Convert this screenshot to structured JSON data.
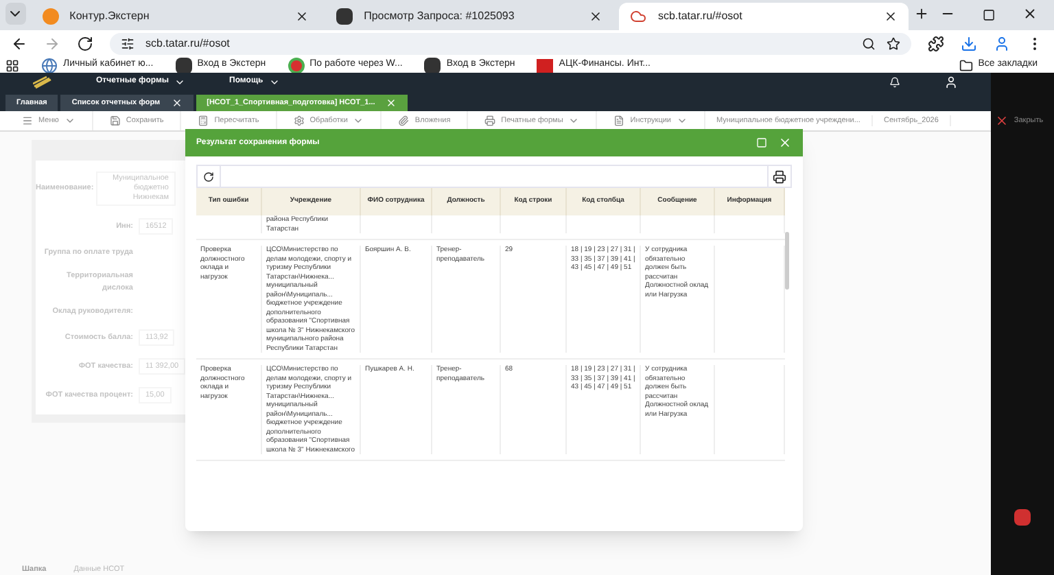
{
  "browser": {
    "tabs": [
      {
        "title": "Контур.Экстерн",
        "kind": "kontur",
        "selected": false
      },
      {
        "title": "Просмотр Запроса: #1025093",
        "kind": "k",
        "selected": false
      },
      {
        "title": "scb.tatar.ru/#osot",
        "kind": "cloud",
        "selected": true
      }
    ],
    "address": "scb.tatar.ru/#osot",
    "bookmarks": [
      {
        "title": "Личный кабинет ю...",
        "kind": "globe"
      },
      {
        "title": "Вход в Экстерн",
        "kind": "k"
      },
      {
        "title": "По работе через W...",
        "kind": "round"
      },
      {
        "title": "Вход в Экстерн",
        "kind": "k"
      },
      {
        "title": "АЦК-Финансы. Инт...",
        "kind": "ack"
      }
    ],
    "all_bookmarks": "Все закладки"
  },
  "app": {
    "menu": [
      "Отчетные формы",
      "Помощь"
    ],
    "tabs": [
      {
        "label": "Главная",
        "selected": false,
        "closable": false
      },
      {
        "label": "Список отчетных форм",
        "selected": false,
        "closable": true
      },
      {
        "label": "[НСОТ_1_Спортивная_подготовка] НСОТ_1...",
        "selected": true,
        "closable": true
      }
    ],
    "toolbar": [
      {
        "label": "Меню",
        "kind": "menu",
        "dropdown": true
      },
      {
        "label": "Сохранить",
        "kind": "save",
        "dropdown": false
      },
      {
        "label": "Пересчитать",
        "kind": "recalc",
        "dropdown": false
      },
      {
        "label": "Обработки",
        "kind": "process",
        "dropdown": true
      },
      {
        "label": "Вложения",
        "kind": "attach",
        "dropdown": false
      },
      {
        "label": "Печатные формы",
        "kind": "print",
        "dropdown": true
      },
      {
        "label": "Инструкции",
        "kind": "doc",
        "dropdown": true
      }
    ],
    "organization": "Муниципальное бюджетное учреждени...",
    "period": "Сентябрь_2026",
    "close": "Закрыть"
  },
  "form": {
    "fields": [
      {
        "label": "Наименование:",
        "value": "Муниципальное бюджетно Нижнекам",
        "kind": "wide"
      },
      {
        "label": "Инн:",
        "value": "16512",
        "kind": "normal"
      },
      {
        "label": "Группа по оплате труда",
        "kind": "normal"
      },
      {
        "label": "Территориальная дислока",
        "kind": "normal"
      },
      {
        "label": "Оклад руководителя:",
        "kind": "normal"
      },
      {
        "label": "Стоимость балла:",
        "value": "113,92",
        "kind": "normal"
      },
      {
        "label": "ФОТ качества:",
        "value": "11 392,00",
        "kind": "normal"
      },
      {
        "label": "ФОТ качества процент:",
        "value": "15,00",
        "kind": "normal"
      }
    ]
  },
  "bottom_tabs": [
    {
      "label": "Шапка",
      "selected": true
    },
    {
      "label": "Данные НСОТ",
      "selected": false
    }
  ],
  "dialog": {
    "title": "Результат сохранения формы",
    "columns": [
      "Тип ошибки",
      "Учреждение",
      "ФИО сотрудника",
      "Должность",
      "Код строки",
      "Код столбца",
      "Сообщение",
      "Информация"
    ],
    "rows": [
      [
        "",
        "района Республики Татарстан",
        "",
        "",
        "",
        "",
        "",
        ""
      ],
      [
        "Проверка должностного оклада и нагрузок",
        "ЦСО\\Министерство по делам молодежи, спорту и туризму Республики Татарстан\\Нижнека... муниципальный район\\Муниципаль... бюджетное учреждение дополнительного образования \"Спортивная школа № 3\" Нижнекамского муниципального района Республики Татарстан",
        "Бояршин А. В.",
        "Тренер-преподаватель",
        "29",
        "18 | 19 | 23 | 27 | 31 | 33 | 35 | 37 | 39 | 41 | 43 | 45 | 47 | 49 | 51",
        "У сотрудника обязательно должен быть рассчитан Должностной оклад или Нагрузка",
        ""
      ],
      [
        "Проверка должностного оклада и нагрузок",
        "ЦСО\\Министерство по делам молодежи, спорту и туризму Республики Татарстан\\Нижнека... муниципальный район\\Муниципаль... бюджетное учреждение дополнительного образования \"Спортивная школа № 3\" Нижнекамского",
        "Пушкарев А. Н.",
        "Тренер-преподаватель",
        "68",
        "18 | 19 | 23 | 27 | 31 | 33 | 35 | 37 | 39 | 41 | 43 | 45 | 47 | 49 | 51",
        "У сотрудника обязательно должен быть рассчитан Должностной оклад или Нагрузка",
        ""
      ]
    ]
  }
}
